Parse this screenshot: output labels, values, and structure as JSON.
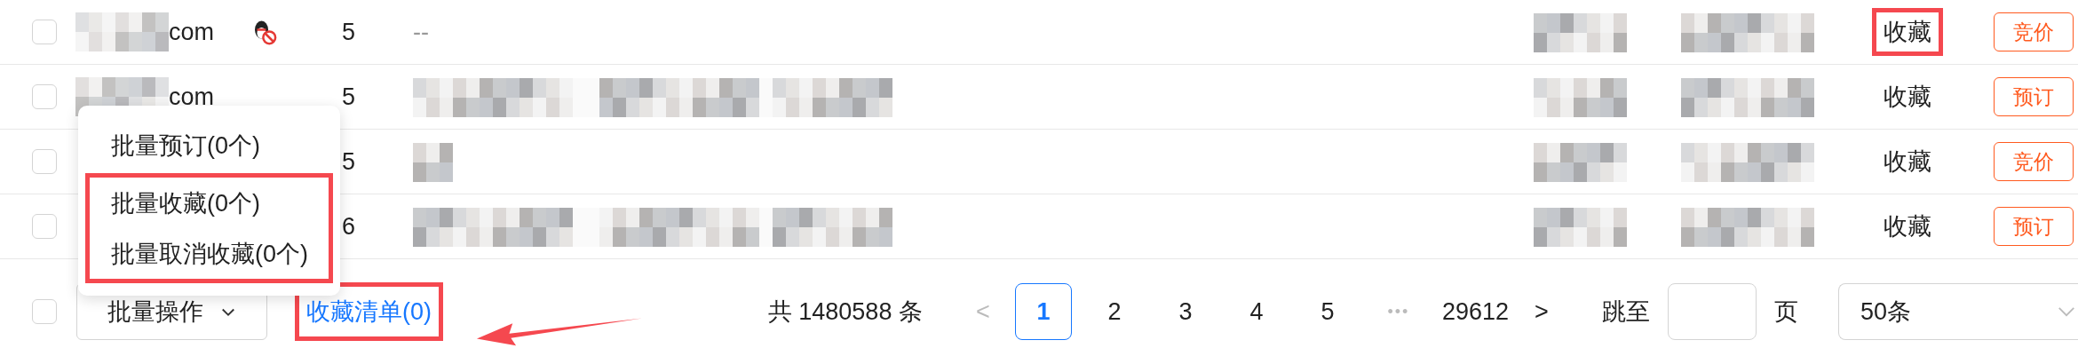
{
  "rows": [
    {
      "checked": false,
      "domain": "com",
      "blocked_icon": true,
      "count": "5",
      "description": {
        "kind": "text",
        "text": "--"
      },
      "favorite": {
        "label": "收藏",
        "highlighted": true
      },
      "action": "竞价"
    },
    {
      "checked": false,
      "domain": "com",
      "blocked_icon": false,
      "count": "5",
      "description": {
        "kind": "redacted"
      },
      "favorite": {
        "label": "收藏",
        "highlighted": false
      },
      "action": "预订"
    },
    {
      "checked": false,
      "blocked_icon": false,
      "count": "5",
      "description": {
        "kind": "redacted"
      },
      "favorite": {
        "label": "收藏",
        "highlighted": false
      },
      "action": "竞价"
    },
    {
      "checked": false,
      "blocked_icon": false,
      "count": "6",
      "description": {
        "kind": "redacted"
      },
      "favorite": {
        "label": "收藏",
        "highlighted": false
      },
      "action": "预订"
    }
  ],
  "batch_menu": {
    "items": [
      {
        "label": "批量预订(0个)",
        "highlighted": false
      },
      {
        "label": "批量收藏(0个)",
        "highlighted": true
      },
      {
        "label": "批量取消收藏(0个)",
        "highlighted": true
      }
    ]
  },
  "footer": {
    "select_all_checked": false,
    "batch_button": "批量操作",
    "favorites_link": {
      "label": "收藏清单(0)",
      "highlighted": true
    },
    "annotation_arrow": true,
    "total": "共 1480588 条",
    "prev": "<",
    "pages": [
      {
        "kind": "page",
        "label": "1",
        "selected": true
      },
      {
        "kind": "page",
        "label": "2",
        "selected": false
      },
      {
        "kind": "page",
        "label": "3",
        "selected": false
      },
      {
        "kind": "page",
        "label": "4",
        "selected": false
      },
      {
        "kind": "page",
        "label": "5",
        "selected": false
      },
      {
        "kind": "ellipsis",
        "label": "•••"
      },
      {
        "kind": "page",
        "label": "29612",
        "selected": false
      }
    ],
    "next": ">",
    "jump_label": "跳至",
    "page_unit": "页",
    "page_size": "50条"
  }
}
